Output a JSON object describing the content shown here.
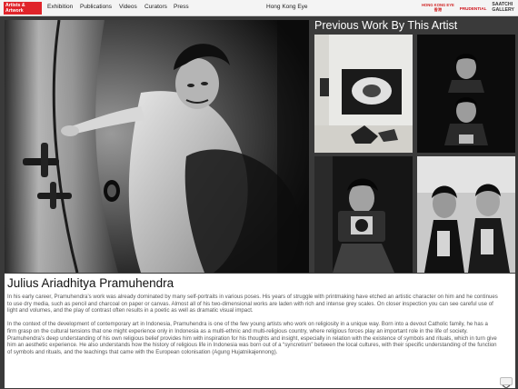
{
  "brand": {
    "line1": "Artists &",
    "line2": "Artwork"
  },
  "nav": {
    "items": [
      {
        "label": "Exhibition"
      },
      {
        "label": "Publications"
      },
      {
        "label": "Videos"
      },
      {
        "label": "Curators"
      },
      {
        "label": "Press"
      }
    ],
    "center_label": "Hong Kong Eye"
  },
  "sponsors": {
    "hk_line1": "HONG KONG EYE",
    "hk_line2": "香港",
    "prudential": "PRUDENTIAL",
    "saatchi_line1": "SAATCHI",
    "saatchi_line2": "GALLERY"
  },
  "previous_works": {
    "title": "Previous Work By This Artist"
  },
  "artist": {
    "name": "Julius Ariadhitya Pramuhendra"
  },
  "bio": {
    "p1": "In his early career, Pramuhendra’s work was already dominated by many self-portraits in various poses.  His years of struggle with printmaking have etched an artistic character on him and he continues to use dry media, such as pencil and charcoal on paper or canvas.  Almost all of his two-dimensional works are laden with rich and intense grey scales.  On closer inspection you can see careful use of light and volumes, and the play of contrast often results in a poetic as well as dramatic visual impact.",
    "p2": "In the context of the development of contemporary art in Indonesia, Pramuhendra is one of the few young artists who work on religiosity in a unique way. Born into a devout Catholic family, he has a firm grasp on the cultural tensions that one might experience only in Indonesia as a multi-ethnic and multi-religious country, where religious forces play an important role in the life of society. Pramuhendra’s deep understanding of his own religious belief provides him with inspiration for his thoughts and insight, especially in relation with the existence of symbols and rituals, which in turn give him an aesthetic experience. He also understands how the history of religious life in Indonesia was born out of a “syncretism” between the local cultures, with their specific understanding of the function of symbols and rituals, and the teachings that came with the European colonisation (Agung Hujatnikajennong)."
  },
  "icons": {
    "scroll": "chevron-down-icon"
  },
  "colors": {
    "brand_red": "#e0242a",
    "page_bg": "#3a3a3a",
    "nav_bg": "#f4f4f4",
    "bio_text": "#555555"
  }
}
